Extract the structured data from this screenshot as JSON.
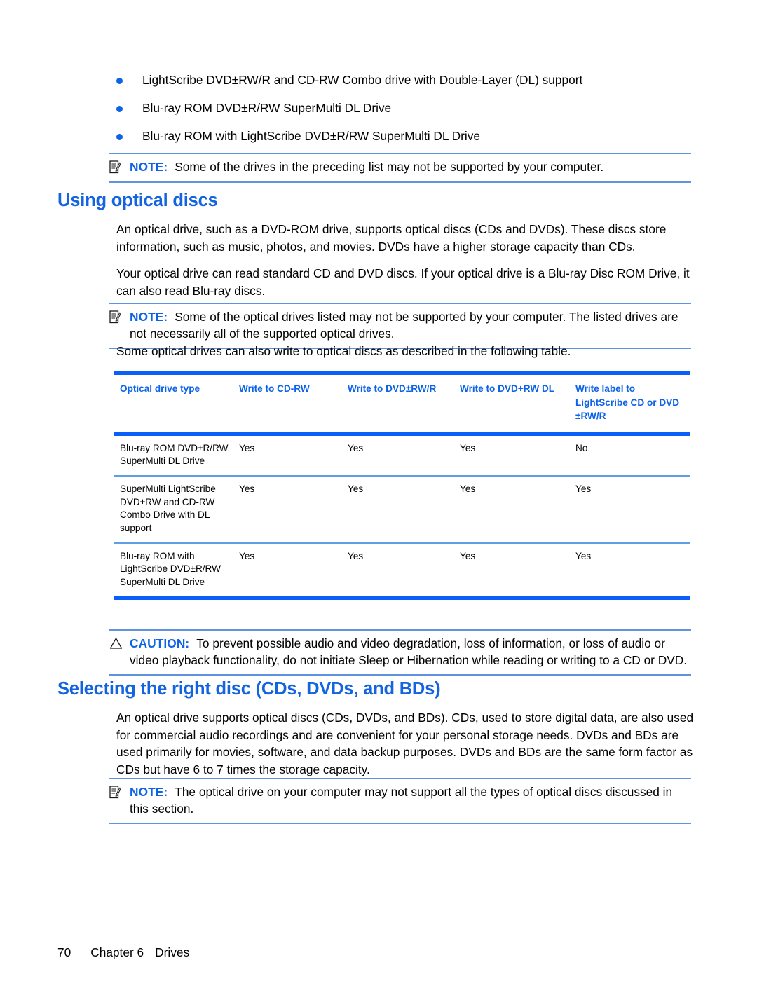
{
  "bullets": [
    {
      "text": "LightScribe DVD±RW/R and CD-RW Combo drive with Double-Layer (DL) support"
    },
    {
      "text": "Blu-ray ROM DVD±R/RW SuperMulti DL Drive"
    },
    {
      "text": "Blu-ray ROM with LightScribe DVD±R/RW SuperMulti DL Drive"
    }
  ],
  "note_top": {
    "icon": "note-icon",
    "label": "NOTE:",
    "text": "Some of the drives in the preceding list may not be supported by your computer."
  },
  "section_one": {
    "heading": "Using optical discs",
    "para1": "An optical drive, such as a DVD-ROM drive, supports optical discs (CDs and DVDs). These discs store information, such as music, photos, and movies. DVDs have a higher storage capacity than CDs.",
    "para2": "Your optical drive can read standard CD and DVD discs. If your optical drive is a Blu-ray Disc ROM Drive, it can also read Blu-ray discs.",
    "note": {
      "icon": "note-icon",
      "label": "NOTE:",
      "text": "Some of the optical drives listed may not be supported by your computer. The listed drives are not necessarily all of the supported optical drives."
    },
    "para3": "Some optical drives can also write to optical discs as described in the following table."
  },
  "table": {
    "headers": [
      "Optical drive type",
      "Write to CD-RW",
      "Write to DVD±RW/R",
      "Write to DVD+RW DL",
      "Write label to LightScribe CD or DVD ±RW/R"
    ],
    "rows": [
      {
        "cells": [
          "Blu-ray ROM DVD±R/RW SuperMulti DL Drive",
          "Yes",
          "Yes",
          "Yes",
          "No"
        ]
      },
      {
        "cells": [
          "SuperMulti LightScribe DVD±RW and CD-RW Combo Drive with DL support",
          "Yes",
          "Yes",
          "Yes",
          "Yes"
        ]
      },
      {
        "cells": [
          "Blu-ray ROM with LightScribe DVD±R/RW SuperMulti DL Drive",
          "Yes",
          "Yes",
          "Yes",
          "Yes"
        ]
      }
    ]
  },
  "caution": {
    "icon": "warning-triangle-icon",
    "label": "CAUTION:",
    "text": "To prevent possible audio and video degradation, loss of information, or loss of audio or video playback functionality, do not initiate Sleep or Hibernation while reading or writing to a CD or DVD."
  },
  "section_two": {
    "heading": "Selecting the right disc (CDs, DVDs, and BDs)",
    "para1": "An optical drive supports optical discs (CDs, DVDs, and BDs). CDs, used to store digital data, are also used for commercial audio recordings and are convenient for your personal storage needs. DVDs and BDs are used primarily for movies, software, and data backup purposes. DVDs and BDs are the same form factor as CDs but have 6 to 7 times the storage capacity.",
    "note": {
      "icon": "note-icon",
      "label": "NOTE:",
      "text": "The optical drive on your computer may not support all the types of optical discs discussed in this section."
    }
  },
  "footer": {
    "page_number": "70",
    "chapter": "Chapter 6",
    "title": "Drives"
  },
  "colors": {
    "heading_blue": "#1464e0",
    "accent_blue": "#0d63e8",
    "rule_thick": "#0a5ffa",
    "rule_thin": "#5f9fe8"
  }
}
